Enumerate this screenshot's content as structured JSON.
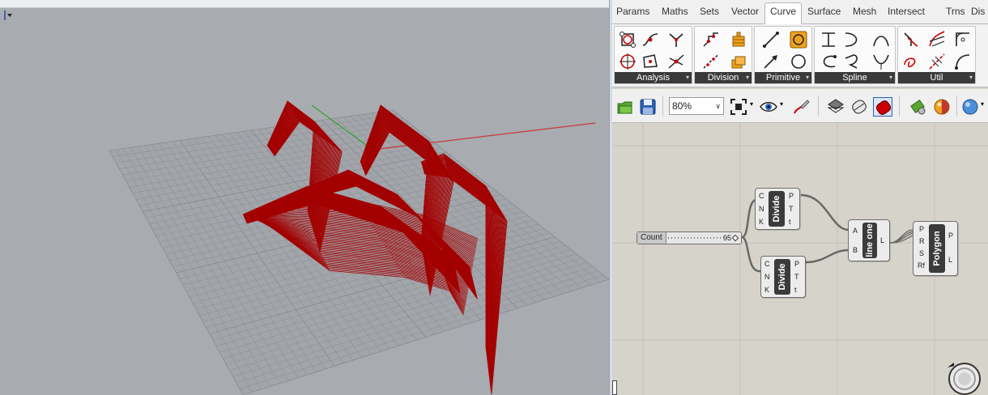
{
  "ribbon_tabs": [
    "Params",
    "Maths",
    "Sets",
    "Vector",
    "Curve",
    "Surface",
    "Mesh",
    "Intersect",
    "Trns",
    "Dis"
  ],
  "active_tab": "Curve",
  "ribbon_groups": [
    "Analysis",
    "Division",
    "Primitive",
    "Spline",
    "Util"
  ],
  "toolbar": {
    "zoom": "80%"
  },
  "canvas": {
    "slider": {
      "label": "Count",
      "value": "95"
    },
    "divide1": {
      "title": "Divide",
      "inputs": [
        "C",
        "N",
        "K"
      ],
      "outputs": [
        "P",
        "T",
        "t"
      ]
    },
    "divide2": {
      "title": "Divide",
      "inputs": [
        "C",
        "N",
        "K"
      ],
      "outputs": [
        "P",
        "T",
        "t"
      ]
    },
    "line": {
      "title": "line one",
      "inputs": [
        "A",
        "B"
      ],
      "outputs": [
        "L"
      ]
    },
    "polygon": {
      "title": "Polygon",
      "inputs": [
        "P",
        "R",
        "S",
        "Rf"
      ],
      "outputs": [
        "P",
        "L"
      ]
    }
  },
  "colors": {
    "viewport_bg": "#a8abb0",
    "geometry": "#a30000",
    "canvas_bg": "#d6d3ca"
  },
  "icons": [
    "viewport-menu-icon",
    "open-file-icon",
    "save-file-icon",
    "zoom-extents-icon",
    "preview-eye-icon",
    "sketch-icon",
    "wireframe-preview-icon",
    "shaded-preview-icon",
    "selected-preview-icon",
    "mesh-settings-icon",
    "material-icon",
    "sphere-display-icon"
  ]
}
